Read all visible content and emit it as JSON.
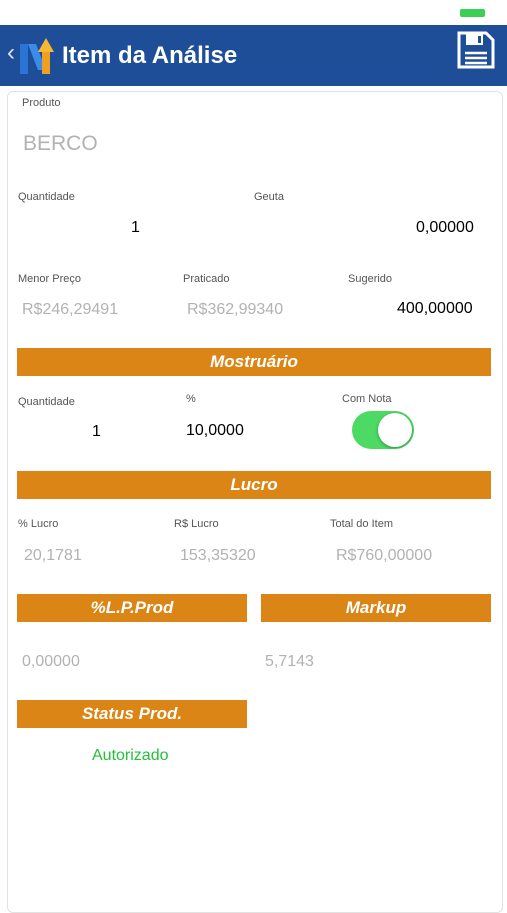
{
  "nav": {
    "back_icon": "chevron-left-icon",
    "logo_icon": "app-logo-icon",
    "title": "Item da Análise",
    "save_icon": "floppy-disk-icon"
  },
  "produto": {
    "label": "Produto",
    "value": "BERCO"
  },
  "quantidade": {
    "label": "Quantidade",
    "value": "1"
  },
  "geuta": {
    "label": "Geuta",
    "value": "0,00000"
  },
  "precos": {
    "menor_label": "Menor Preço",
    "menor_value": "R$246,29491",
    "praticado_label": "Praticado",
    "praticado_value": "R$362,99340",
    "sugerido_label": "Sugerido",
    "sugerido_value": "400,00000"
  },
  "mostruario": {
    "header": "Mostruário",
    "quantidade_label": "Quantidade",
    "quantidade_value": "1",
    "percent_label": "%",
    "percent_value": "10,0000",
    "com_nota_label": "Com Nota",
    "com_nota_on": true
  },
  "lucro": {
    "header": "Lucro",
    "pct_label": "% Lucro",
    "pct_value": "20,1781",
    "rs_label": "R$ Lucro",
    "rs_value": "153,35320",
    "total_label": "Total do Item",
    "total_value": "R$760,00000"
  },
  "lp_prod": {
    "header": "%L.P.Prod",
    "value": "0,00000"
  },
  "markup": {
    "header": "Markup",
    "value": "5,7143"
  },
  "status": {
    "header": "Status Prod.",
    "value": "Autorizado"
  },
  "colors": {
    "navbar": "#1f4e98",
    "section_header": "#da8515",
    "toggle_on": "#4cd964",
    "status_ok": "#22c13a"
  }
}
